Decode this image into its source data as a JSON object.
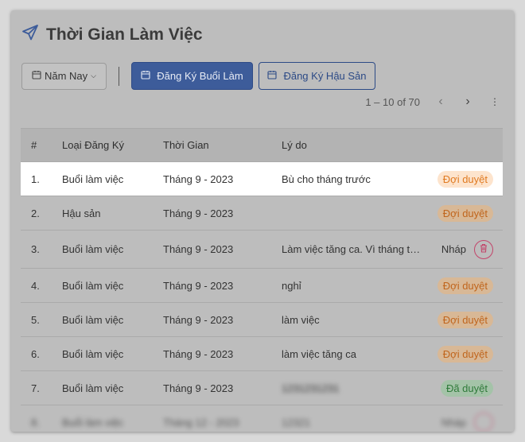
{
  "page": {
    "title": "Thời Gian Làm Việc",
    "title_icon": "paper-plane-icon"
  },
  "toolbar": {
    "year_filter": "Năm Nay",
    "register_work_label": "Đăng Ký Buổi Làm",
    "register_maternity_label": "Đăng Ký Hậu Sản"
  },
  "pagination": {
    "range_text": "1 – 10 of 70"
  },
  "table": {
    "columns": [
      "#",
      "Loại Đăng Ký",
      "Thời Gian",
      "Lý do"
    ],
    "rows": [
      {
        "num": "1.",
        "type": "Buổi làm việc",
        "time": "Tháng 9 - 2023",
        "reason": "Bù cho tháng trước",
        "status": "Đợi duyệt"
      },
      {
        "num": "2.",
        "type": "Hậu sản",
        "time": "Tháng 9 - 2023",
        "reason": "",
        "status": "Đợi duyệt"
      },
      {
        "num": "3.",
        "type": "Buổi làm việc",
        "time": "Tháng 9 - 2023",
        "reason": "Làm việc tăng ca. Vì tháng trư...",
        "status": "Nháp"
      },
      {
        "num": "4.",
        "type": "Buổi làm việc",
        "time": "Tháng 9 - 2023",
        "reason": "nghỉ",
        "status": "Đợi duyệt"
      },
      {
        "num": "5.",
        "type": "Buổi làm việc",
        "time": "Tháng 9 - 2023",
        "reason": "làm việc",
        "status": "Đợi duyệt"
      },
      {
        "num": "6.",
        "type": "Buổi làm việc",
        "time": "Tháng 9 - 2023",
        "reason": "làm việc tăng ca",
        "status": "Đợi duyệt"
      },
      {
        "num": "7.",
        "type": "Buổi làm việc",
        "time": "Tháng 9 - 2023",
        "reason": "1231231231",
        "status": "Đã duyệt"
      },
      {
        "num": "8.",
        "type": "Buổi làm việc",
        "time": "Tháng 12 - 2023",
        "reason": "12321",
        "status": "Nháp"
      }
    ]
  },
  "colors": {
    "primary": "#3d5c9a",
    "pending": "#e07a21",
    "approved": "#2f7a3a",
    "delete": "#c2446a"
  }
}
